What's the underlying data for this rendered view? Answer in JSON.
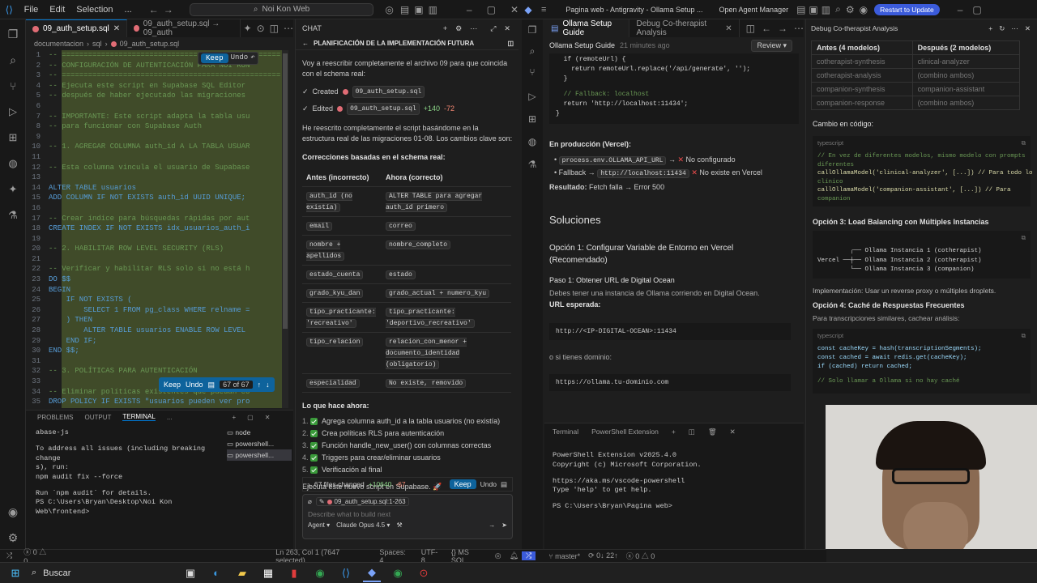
{
  "left_window": {
    "menu": [
      "File",
      "Edit",
      "Selection",
      "..."
    ],
    "search": "Noi Kon Web",
    "tabs": [
      {
        "label": "09_auth_setup.sql",
        "active": true
      },
      {
        "label": "09_auth_setup.sql → 09_auth",
        "active": false
      }
    ],
    "breadcrumb": [
      "documentacion",
      "sql",
      "09_auth_setup.sql"
    ],
    "keep_label": "Keep",
    "undo_label": "Undo",
    "change_counter": "67 of 67",
    "code": [
      {
        "n": "1",
        "t": "-- ==================================================",
        "c": "cm"
      },
      {
        "n": "2",
        "t": "-- CONFIGURACIÓN DE AUTENTICACIÓN PARA NOI KON",
        "c": "cm"
      },
      {
        "n": "3",
        "t": "-- ==================================================",
        "c": "cm"
      },
      {
        "n": "4",
        "t": "-- Ejecuta este script en Supabase SQL Editor",
        "c": "cm"
      },
      {
        "n": "5",
        "t": "-- después de haber ejecutado las migraciones",
        "c": "cm"
      },
      {
        "n": "6",
        "t": "",
        "c": ""
      },
      {
        "n": "7",
        "t": "-- IMPORTANTE: Este script adapta la tabla usu",
        "c": "cm"
      },
      {
        "n": "8",
        "t": "-- para funcionar con Supabase Auth",
        "c": "cm"
      },
      {
        "n": "9",
        "t": "",
        "c": ""
      },
      {
        "n": "10",
        "t": "-- 1. AGREGAR COLUMNA auth_id A LA TABLA USUAR",
        "c": "cm"
      },
      {
        "n": "11",
        "t": "",
        "c": ""
      },
      {
        "n": "12",
        "t": "-- Esta columna vincula el usuario de Supabase",
        "c": "cm"
      },
      {
        "n": "13",
        "t": "",
        "c": ""
      },
      {
        "n": "14",
        "t": "ALTER TABLE usuarios",
        "c": "kw"
      },
      {
        "n": "15",
        "t": "ADD COLUMN IF NOT EXISTS auth_id UUID UNIQUE;",
        "c": "kw"
      },
      {
        "n": "16",
        "t": "",
        "c": ""
      },
      {
        "n": "17",
        "t": "-- Crear índice para búsquedas rápidas por aut",
        "c": "cm"
      },
      {
        "n": "18",
        "t": "CREATE INDEX IF NOT EXISTS idx_usuarios_auth_i",
        "c": "kw"
      },
      {
        "n": "19",
        "t": "",
        "c": ""
      },
      {
        "n": "20",
        "t": "-- 2. HABILITAR ROW LEVEL SECURITY (RLS)",
        "c": "cm"
      },
      {
        "n": "21",
        "t": "",
        "c": ""
      },
      {
        "n": "22",
        "t": "-- Verificar y habilitar RLS solo si no está h",
        "c": "cm"
      },
      {
        "n": "23",
        "t": "DO $$",
        "c": "kw"
      },
      {
        "n": "24",
        "t": "BEGIN",
        "c": "kw"
      },
      {
        "n": "25",
        "t": "    IF NOT EXISTS (",
        "c": "kw"
      },
      {
        "n": "26",
        "t": "        SELECT 1 FROM pg_class WHERE relname =",
        "c": "kw"
      },
      {
        "n": "27",
        "t": "    ) THEN",
        "c": "kw"
      },
      {
        "n": "28",
        "t": "        ALTER TABLE usuarios ENABLE ROW LEVEL",
        "c": "kw"
      },
      {
        "n": "29",
        "t": "    END IF;",
        "c": "kw"
      },
      {
        "n": "30",
        "t": "END $$;",
        "c": "kw"
      },
      {
        "n": "31",
        "t": "",
        "c": ""
      },
      {
        "n": "32",
        "t": "-- 3. POLÍTICAS PARA AUTENTICACIÓN",
        "c": "cm"
      },
      {
        "n": "33",
        "t": "",
        "c": ""
      },
      {
        "n": "34",
        "t": "-- Eliminar políticas existentes que puedan co",
        "c": "cm"
      },
      {
        "n": "35",
        "t": "DROP POLICY IF EXISTS \"usuarios pueden ver pro",
        "c": "kw"
      }
    ],
    "panel_tabs": [
      "PROBLEMS",
      "OUTPUT",
      "TERMINAL",
      "..."
    ],
    "terminal_lines": [
      "abase-js",
      "",
      "To address all issues (including breaking change",
      "s), run:",
      "  npm audit fix --force",
      "",
      "Run `npm audit` for details.",
      "PS C:\\Users\\Bryan\\Desktop\\Noi Kon Web\\frontend>"
    ],
    "terminal_sessions": [
      "node",
      "powershell...",
      "powershell..."
    ],
    "status": {
      "errors": "0",
      "warnings": "0",
      "position": "Ln 263, Col 1 (7647 selected)",
      "spaces": "Spaces: 4",
      "encoding": "UTF-8",
      "language": "MS SQL"
    }
  },
  "chat": {
    "header": "CHAT",
    "title": "PLANIFICACIÓN DE LA IMPLEMENTACIÓN FUTURA",
    "intro": "Voy a reescribir completamente el archivo 09 para que coincida con el schema real:",
    "created_label": "Created",
    "created_file": "09_auth_setup.sql",
    "edited_label": "Edited",
    "edited_file": "09_auth_setup.sql",
    "edited_add": "+140",
    "edited_del": "-72",
    "para": "He reescrito completamente el script basándome en la estructura real de las migraciones 01-08. Los cambios clave son:",
    "section": "Correcciones basadas en el schema real:",
    "table_head": [
      "Antes (incorrecto)",
      "Ahora (correcto)"
    ],
    "table_rows": [
      {
        "before": "auth_id (no existía)",
        "after": "ALTER TABLE para agregar auth_id primero"
      },
      {
        "before": "email",
        "after": "correo"
      },
      {
        "before": "nombre + apellidos",
        "after": "nombre_completo"
      },
      {
        "before": "estado_cuenta",
        "after": "estado"
      },
      {
        "before": "grado_kyu_dan",
        "after": "grado_actual + numero_kyu"
      },
      {
        "before": "tipo_practicante: 'recreativo'",
        "after": "tipo_practicante: 'deportivo_recreativo'"
      },
      {
        "before": "tipo_relacion",
        "after": "relacion_con_menor + documento_identidad (obligatorio)"
      },
      {
        "before": "especialidad",
        "after": "No existe, removido"
      }
    ],
    "now_title": "Lo que hace ahora:",
    "checks": [
      "Agrega columna auth_id a la tabla usuarios (no existía)",
      "Crea políticas RLS para autenticación",
      "Función handle_new_user() con columnas correctas",
      "Triggers para crear/eliminar usuarios",
      "Verificación al final"
    ],
    "closing": "Ejecuta este nuevo script en Supabase. 🚀",
    "files_changed": "67 files changed",
    "files_add": "+10640",
    "files_del": "-67",
    "keep_label": "Keep",
    "undo_label": "Undo",
    "context_file": "09_auth_setup.sql:1-263",
    "input_placeholder": "Describe what to build next",
    "agent_label": "Agent",
    "model_label": "Claude Opus 4.5"
  },
  "right_window": {
    "title": "Pagina web - Antigravity - Ollama Setup ...",
    "agent_manager": "Open Agent Manager",
    "restart_label": "Restart to Update",
    "tabs": [
      {
        "label": "Ollama Setup Guide",
        "active": true
      },
      {
        "label": "Debug Co-therapist Analysis",
        "active": false
      }
    ],
    "doc_title": "Ollama Setup Guide",
    "doc_time": "21 minutes ago",
    "review_label": "Review",
    "code_top": [
      "  if (remoteUrl) {",
      "    return remoteUrl.replace('/api/generate', '');",
      "  }",
      "",
      "  // Fallback: localhost",
      "  return 'http://localhost:11434';",
      "}"
    ],
    "prod_heading": "En producción (Vercel):",
    "prod_items": [
      {
        "code": "process.env.OLLAMA_API_URL",
        "arrow": "→",
        "text": "No configurado"
      },
      {
        "code": "http://localhost:11434",
        "arrow": "Fallback →",
        "text": "No existe en Vercel"
      }
    ],
    "result_label": "Resultado:",
    "result_text": "Fetch falla → Error 500",
    "solutions": "Soluciones",
    "opt1": "Opción 1: Configurar Variable de Entorno en Vercel (Recomendado)",
    "step1": "Paso 1: Obtener URL de Digital Ocean",
    "step1_text": "Debes tener una instancia de Ollama corriendo en Digital Ocean.",
    "url_label": "URL esperada:",
    "url_code": "http://<IP-DIGITAL-OCEAN>:11434",
    "or_domain": "o si tienes dominio:",
    "domain_code": "https://ollama.tu-dominio.com",
    "terminal_tabs": [
      "Terminal",
      "PowerShell Extension"
    ],
    "terminal_lines": [
      "PowerShell Extension v2025.4.0",
      "Copyright (c) Microsoft Corporation.",
      "",
      "https://aka.ms/vscode-powershell",
      "Type 'help' to get help.",
      "",
      "PS C:\\Users\\Bryan\\Pagina web>"
    ],
    "status": {
      "branch": "master*",
      "sync": "0↓ 22↑",
      "errors": "0",
      "warnings": "0"
    }
  },
  "side_panel": {
    "title": "Debug Co-therapist Analysis",
    "table_head": [
      "Antes (4 modelos)",
      "Después (2 modelos)"
    ],
    "table_rows": [
      [
        "cotherapist-synthesis",
        "clinical-analyzer"
      ],
      [
        "cotherapist-analysis",
        "(combino ambos)"
      ],
      [
        "companion-synthesis",
        "companion-assistant"
      ],
      [
        "companion-response",
        "(combino ambos)"
      ]
    ],
    "code_change": "Cambio en código:",
    "lang1": "typescript",
    "code1": [
      "// En vez de diferentes modelos, mismo modelo con prompts",
      "diferentes",
      "callOllamaModel('clinical-analyzer', [...]) // Para todo lo",
      "clínico",
      "callOllamaModel('companion-assistant', [...]) // Para",
      "companion"
    ],
    "opt3": "Opción 3: Load Balancing con Múltiples Instancias",
    "diagram": [
      "         ┌── Ollama Instancia 1 (cotherapist)",
      "Vercel ──┼── Ollama Instancia 2 (cotherapist)",
      "         └── Ollama Instancia 3 (companion)"
    ],
    "impl": "Implementación: Usar un reverse proxy o múltiples droplets.",
    "opt4": "Opción 4: Caché de Respuestas Frecuentes",
    "opt4_text": "Para transcripciones similares, cachear análisis:",
    "lang2": "typescript",
    "code2": [
      "const cacheKey = hash(transcriptionSegments);",
      "const cached = await redis.get(cacheKey);",
      "if (cached) return cached;",
      "",
      "// Solo llamar a Ollama si no hay caché"
    ]
  },
  "taskbar": {
    "search": "Buscar"
  }
}
